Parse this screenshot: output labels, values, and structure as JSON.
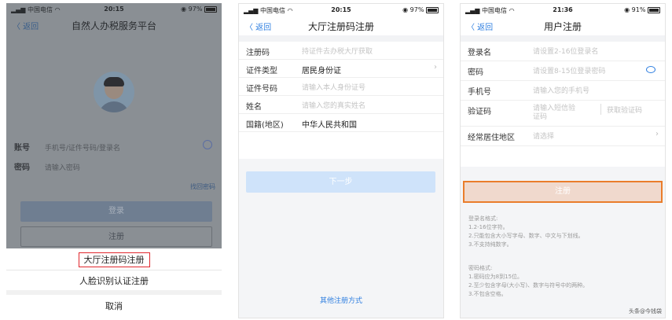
{
  "phone1": {
    "status": {
      "carrier": "中国电信",
      "time": "20:15",
      "battery": "97%"
    },
    "nav": {
      "back": "〈 返回",
      "title": "自然人办税服务平台"
    },
    "account_label": "账号",
    "account_placeholder": "手机号/证件号码/登录名",
    "password_label": "密码",
    "password_placeholder": "请输入密码",
    "forgot": "找回密码",
    "login_btn": "登录",
    "register_btn": "注册",
    "sheet": {
      "option1": "大厅注册码注册",
      "option2": "人脸识别认证注册",
      "cancel": "取消"
    }
  },
  "phone2": {
    "status": {
      "carrier": "中国电信",
      "time": "20:15",
      "battery": "97%"
    },
    "nav": {
      "back": "〈 返回",
      "title": "大厅注册码注册"
    },
    "rows": [
      {
        "label": "注册码",
        "value": "持证件去办税大厅获取",
        "filled": false,
        "chevron": false
      },
      {
        "label": "证件类型",
        "value": "居民身份证",
        "filled": true,
        "chevron": true
      },
      {
        "label": "证件号码",
        "value": "请输入本人身份证号",
        "filled": false,
        "chevron": false
      },
      {
        "label": "姓名",
        "value": "请输入您的真实姓名",
        "filled": false,
        "chevron": false
      },
      {
        "label": "国籍(地区)",
        "value": "中华人民共和国",
        "filled": true,
        "chevron": false
      }
    ],
    "next_btn": "下一步",
    "other_way": "其他注册方式"
  },
  "phone3": {
    "status": {
      "carrier": "中国电信",
      "time": "21:36",
      "battery": "91%"
    },
    "nav": {
      "back": "〈 返回",
      "title": "用户注册"
    },
    "rows": {
      "login_name": {
        "label": "登录名",
        "placeholder": "请设置2-16位登录名"
      },
      "password": {
        "label": "密码",
        "placeholder": "请设置8-15位登录密码"
      },
      "phone": {
        "label": "手机号",
        "placeholder": "请输入您的手机号"
      },
      "code": {
        "label": "验证码",
        "placeholder_line1": "请输入短信验",
        "placeholder_line2": "证码",
        "get_code": "获取验证码"
      },
      "region": {
        "label": "经常居住地区",
        "placeholder": "请选择"
      }
    },
    "register_btn": "注册",
    "rules_login": [
      "登录名格式:",
      "1.2-16位字符。",
      "2.只能包含大小写字母、数字、中文与下划线。",
      "3.不支持纯数字。"
    ],
    "rules_password": [
      "密码格式:",
      "1.密码应为8到15位。",
      "2.至少包含字母(大小写)、数字与符号中的两种。",
      "3.不包含空格。"
    ],
    "watermark": "头条@今钱袋"
  },
  "colors": {
    "accent": "#2f7fe0",
    "highlight_red": "#e0272d",
    "highlight_orange": "#ea7d2b"
  }
}
